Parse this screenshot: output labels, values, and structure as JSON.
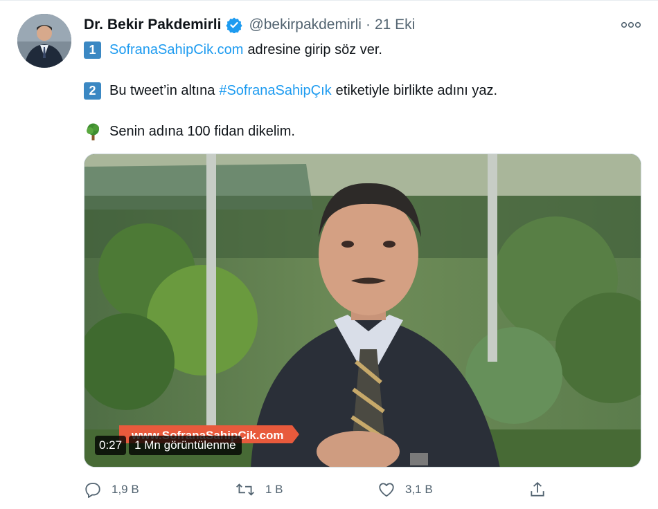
{
  "tweet": {
    "author_name": "Dr. Bekir Pakdemirli",
    "handle": "@bekirpakdemirli",
    "separator": "·",
    "time": "21 Eki",
    "line1": {
      "keycap": "1",
      "link": "SofranaSahipCik.com",
      "text": "adresine girip söz ver."
    },
    "line2": {
      "keycap": "2",
      "text_before": "Bu tweet’in altına",
      "hashtag": "#SofranaSahipÇık",
      "text_after": "etiketiyle birlikte adını yaz."
    },
    "line3": {
      "icon": "tree-emoji",
      "text": "Senin adına 100 fidan dikelim."
    },
    "video": {
      "duration": "0:27",
      "views": "1 Mn görüntülenme",
      "overlay_banner": "www.SofranaSahipCik.com"
    },
    "actions": {
      "reply_count": "1,9 B",
      "retweet_count": "1 B",
      "like_count": "3,1 B"
    }
  },
  "colors": {
    "link": "#1d9bf0",
    "secondary_text": "#536471",
    "keycap": "#3b88c3",
    "verified": "#1d9bf0"
  }
}
